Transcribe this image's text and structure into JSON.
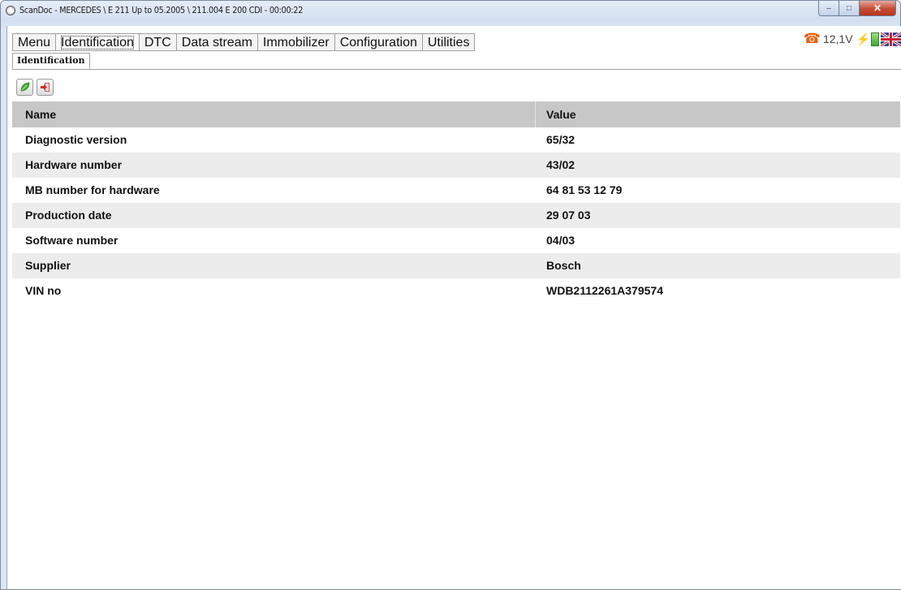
{
  "window": {
    "title": "ScanDoc - MERCEDES \\ E 211 Up to 05.2005 \\ 211.004 E 200 CDI - 00:00:22",
    "controls": {
      "minimize": "–",
      "maximize": "□",
      "close": "✕"
    }
  },
  "menu": {
    "tabs": [
      {
        "label": "Menu"
      },
      {
        "label": "Identification",
        "active": true
      },
      {
        "label": "DTC"
      },
      {
        "label": "Data stream"
      },
      {
        "label": "Immobilizer"
      },
      {
        "label": "Configuration"
      },
      {
        "label": "Utilities"
      }
    ]
  },
  "status": {
    "voltage": "12,1V",
    "icons": [
      "phone-icon",
      "battery-plug-icon",
      "uk-flag-icon"
    ],
    "colors": {
      "phone": "#e2600f",
      "battery": "#3ca83c"
    }
  },
  "subtab": {
    "label": "Identification"
  },
  "toolbar": {
    "icons": [
      "green-leaf-icon",
      "export-arrow-icon"
    ]
  },
  "table": {
    "headers": {
      "name": "Name",
      "value": "Value"
    },
    "rows": [
      {
        "name": "Diagnostic version",
        "value": "65/32"
      },
      {
        "name": "Hardware number",
        "value": "43/02"
      },
      {
        "name": "MB number for hardware",
        "value": "64 81 53 12 79"
      },
      {
        "name": "Production date",
        "value": "29 07 03"
      },
      {
        "name": "Software number",
        "value": "04/03"
      },
      {
        "name": "Supplier",
        "value": "Bosch"
      },
      {
        "name": "VIN no",
        "value": "WDB2112261A379574"
      }
    ]
  }
}
